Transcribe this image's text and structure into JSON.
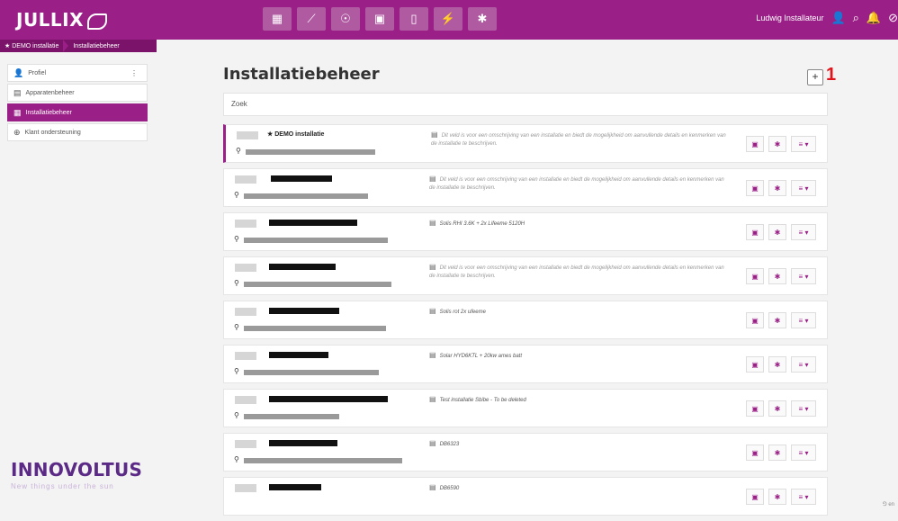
{
  "app": {
    "logo": "JULLIX"
  },
  "topbar": {
    "nav_icons": [
      "dashboard-icon",
      "chart-icon",
      "piggy-bank-icon",
      "money-icon",
      "battery-icon",
      "plug-icon",
      "gear-icon"
    ],
    "nav_glyphs": [
      "▦",
      "⟋",
      "☉",
      "▣",
      "▯",
      "⚡",
      "✱"
    ],
    "user_name": "Ludwig Installateur",
    "user_glyph": "👤",
    "search_glyph": "⌕",
    "bell_glyph": "🔔",
    "help_glyph": "⊘"
  },
  "breadcrumb": {
    "home": "★ DEMO installatie",
    "current": "Installatiebeheer"
  },
  "sidebar": {
    "items": [
      {
        "label": "Profiel",
        "glyph": "👤",
        "icon": "user-icon",
        "kebab": "⋮"
      },
      {
        "label": "Apparatenbeheer",
        "glyph": "▤",
        "icon": "devices-icon"
      },
      {
        "label": "Installatiebeheer",
        "glyph": "▦",
        "icon": "installations-icon"
      },
      {
        "label": "Klant ondersteuning",
        "glyph": "⊕",
        "icon": "support-icon"
      }
    ]
  },
  "brand": {
    "name": "INNOVOLTUS",
    "tagline": "New things under the sun"
  },
  "main": {
    "title": "Installatiebeheer",
    "add_label": "+",
    "annotation": "1",
    "search_placeholder": "Zoek"
  },
  "rows": [
    {
      "name": "★ DEMO installatie",
      "note": "Dit veld is voor een omschrijving van een installatie en biedt de mogelijkheid om aanvullende details en kenmerken van de installatie te beschrijven.",
      "placeholder": true
    },
    {
      "name": "",
      "note": "Dit veld is voor een omschrijving van een installatie en biedt de mogelijkheid om aanvullende details en kenmerken van de installatie te beschrijven.",
      "placeholder": true
    },
    {
      "name": "",
      "note": "Solis RHI 3.6K + 2x Lifeeme 5120H",
      "placeholder": false
    },
    {
      "name": "",
      "note": "Dit veld is voor een omschrijving van een installatie en biedt de mogelijkheid om aanvullende details en kenmerken van de installatie te beschrijven.",
      "placeholder": true
    },
    {
      "name": "",
      "note": "Solis rot 2x ufeeme",
      "placeholder": false
    },
    {
      "name": "",
      "note": "Solar HYD6KTL + 20kw ames batt",
      "placeholder": false
    },
    {
      "name": "",
      "note": "Test installatie Sbibe - To be deleted",
      "placeholder": false
    },
    {
      "name": "",
      "note": "DB6323",
      "placeholder": false
    },
    {
      "name": "",
      "note": "DB6590",
      "placeholder": false
    }
  ],
  "row_actions": {
    "calendar": "▣",
    "settings": "✱",
    "menu": "≡ ▾"
  },
  "footer": {
    "text": "⅁ en"
  },
  "colors": {
    "brand": "#9a1f86",
    "annotation": "#e0141a"
  }
}
